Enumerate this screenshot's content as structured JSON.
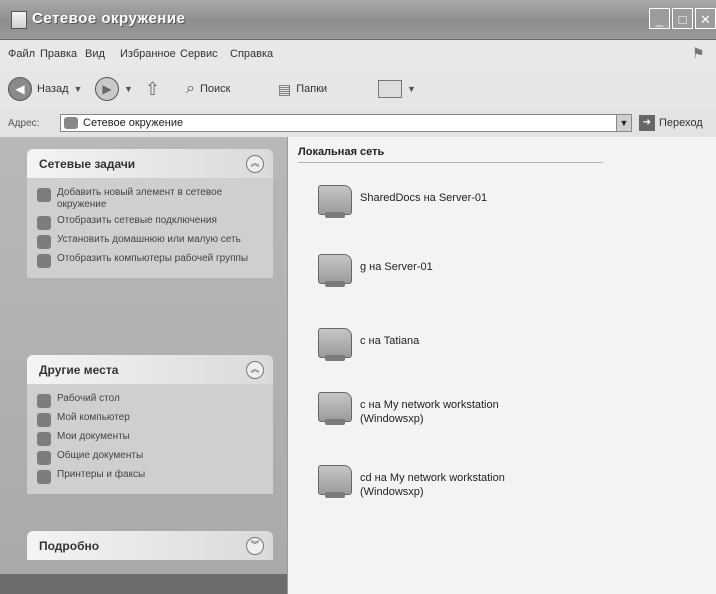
{
  "window": {
    "title": "Сетевое окружение",
    "controls": [
      "_",
      "□",
      "✕"
    ]
  },
  "menu": {
    "items": [
      "Файл",
      "Правка",
      "Вид",
      "Избранное",
      "Сервис",
      "Справка"
    ]
  },
  "toolbar": {
    "back_label": "Назад",
    "search_label": "Поиск",
    "folders_label": "Папки"
  },
  "address": {
    "label": "Адрес:",
    "value": "Сетевое окружение",
    "go_label": "Переход"
  },
  "left_pane": {
    "network_tasks": {
      "title": "Сетевые задачи",
      "items": [
        "Добавить новый элемент в сетевое окружение",
        "Отобразить сетевые подключения",
        "Установить домашнюю или малую сеть",
        "Отобразить компьютеры рабочей группы"
      ]
    },
    "other_places": {
      "title": "Другие места",
      "items": [
        "Рабочий стол",
        "Мой компьютер",
        "Мои документы",
        "Общие документы",
        "Принтеры и факсы"
      ]
    },
    "details": {
      "title": "Подробно"
    }
  },
  "main": {
    "group_title": "Локальная сеть",
    "items": [
      {
        "label": "SharedDocs на Server-01"
      },
      {
        "label": "g на Server-01"
      },
      {
        "label": "c на Tatiana"
      },
      {
        "label": "c на My network workstation (Windowsxp)"
      },
      {
        "label": "cd на My network workstation (Windowsxp)"
      }
    ]
  }
}
